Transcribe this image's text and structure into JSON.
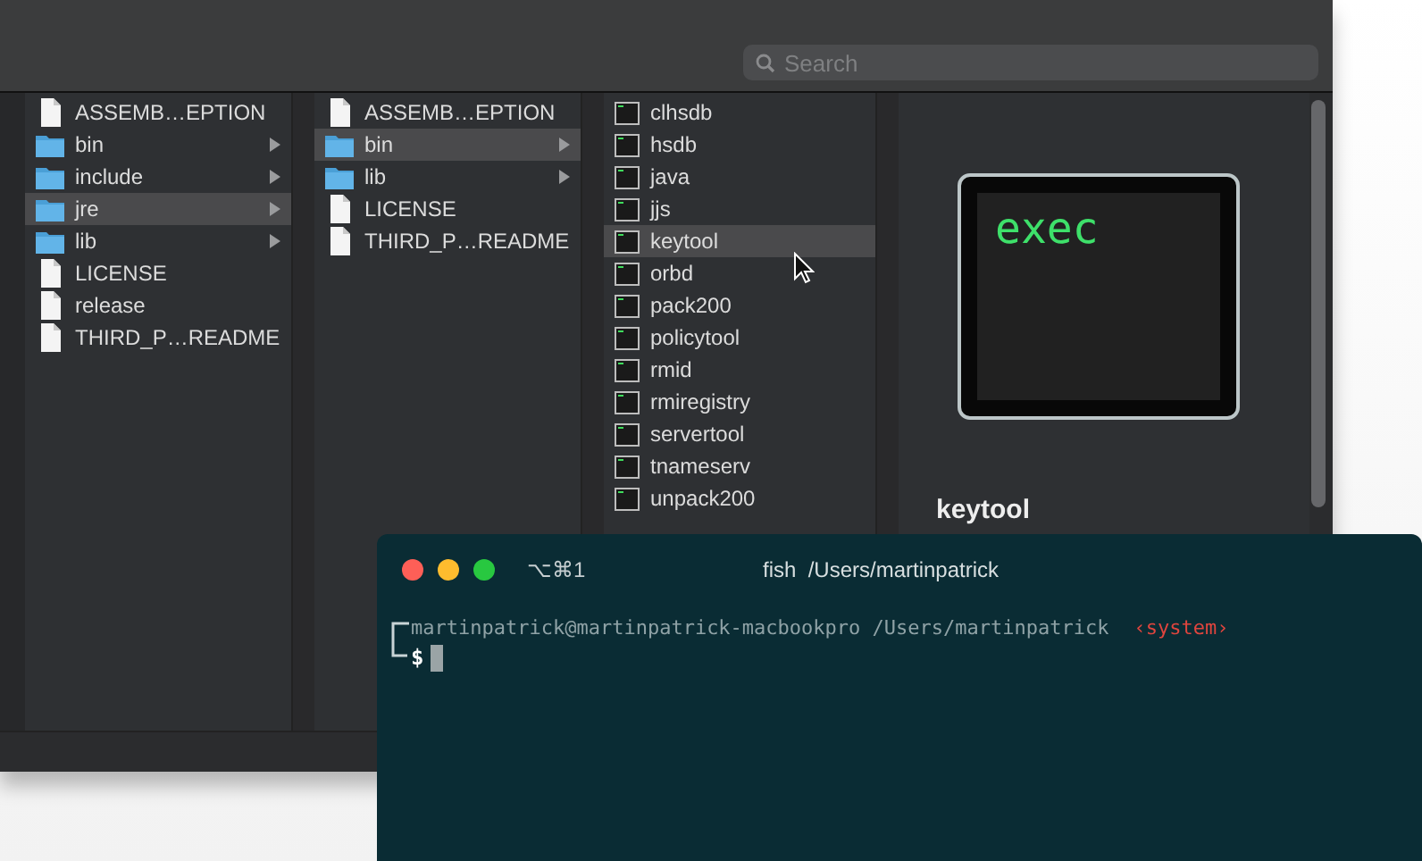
{
  "finder": {
    "search": {
      "placeholder": "Search"
    },
    "columns": [
      {
        "items": [
          {
            "name": "ASSEMB…EPTION",
            "kind": "file",
            "selected": false
          },
          {
            "name": "bin",
            "kind": "folder",
            "selected": false
          },
          {
            "name": "include",
            "kind": "folder",
            "selected": false
          },
          {
            "name": "jre",
            "kind": "folder",
            "selected": true
          },
          {
            "name": "lib",
            "kind": "folder",
            "selected": false
          },
          {
            "name": "LICENSE",
            "kind": "file",
            "selected": false
          },
          {
            "name": "release",
            "kind": "file",
            "selected": false
          },
          {
            "name": "THIRD_P…README",
            "kind": "file",
            "selected": false
          }
        ]
      },
      {
        "items": [
          {
            "name": "ASSEMB…EPTION",
            "kind": "file",
            "selected": false
          },
          {
            "name": "bin",
            "kind": "folder",
            "selected": true
          },
          {
            "name": "lib",
            "kind": "folder",
            "selected": false
          },
          {
            "name": "LICENSE",
            "kind": "file",
            "selected": false
          },
          {
            "name": "THIRD_P…README",
            "kind": "file",
            "selected": false
          }
        ]
      },
      {
        "items": [
          {
            "name": "clhsdb",
            "kind": "exec",
            "selected": false
          },
          {
            "name": "hsdb",
            "kind": "exec",
            "selected": false
          },
          {
            "name": "java",
            "kind": "exec",
            "selected": false
          },
          {
            "name": "jjs",
            "kind": "exec",
            "selected": false
          },
          {
            "name": "keytool",
            "kind": "exec",
            "selected": true
          },
          {
            "name": "orbd",
            "kind": "exec",
            "selected": false
          },
          {
            "name": "pack200",
            "kind": "exec",
            "selected": false
          },
          {
            "name": "policytool",
            "kind": "exec",
            "selected": false
          },
          {
            "name": "rmid",
            "kind": "exec",
            "selected": false
          },
          {
            "name": "rmiregistry",
            "kind": "exec",
            "selected": false
          },
          {
            "name": "servertool",
            "kind": "exec",
            "selected": false
          },
          {
            "name": "tnameserv",
            "kind": "exec",
            "selected": false
          },
          {
            "name": "unpack200",
            "kind": "exec",
            "selected": false
          }
        ]
      }
    ],
    "preview": {
      "icon_text": "exec",
      "name": "keytool"
    }
  },
  "terminal": {
    "shortcut": "⌥⌘1",
    "title": "fish  /Users/martinpatrick",
    "prompt_path": "martinpatrick@martinpatrick-macbookpro /Users/martinpatrick",
    "mode": "‹system›",
    "prompt": "$"
  }
}
